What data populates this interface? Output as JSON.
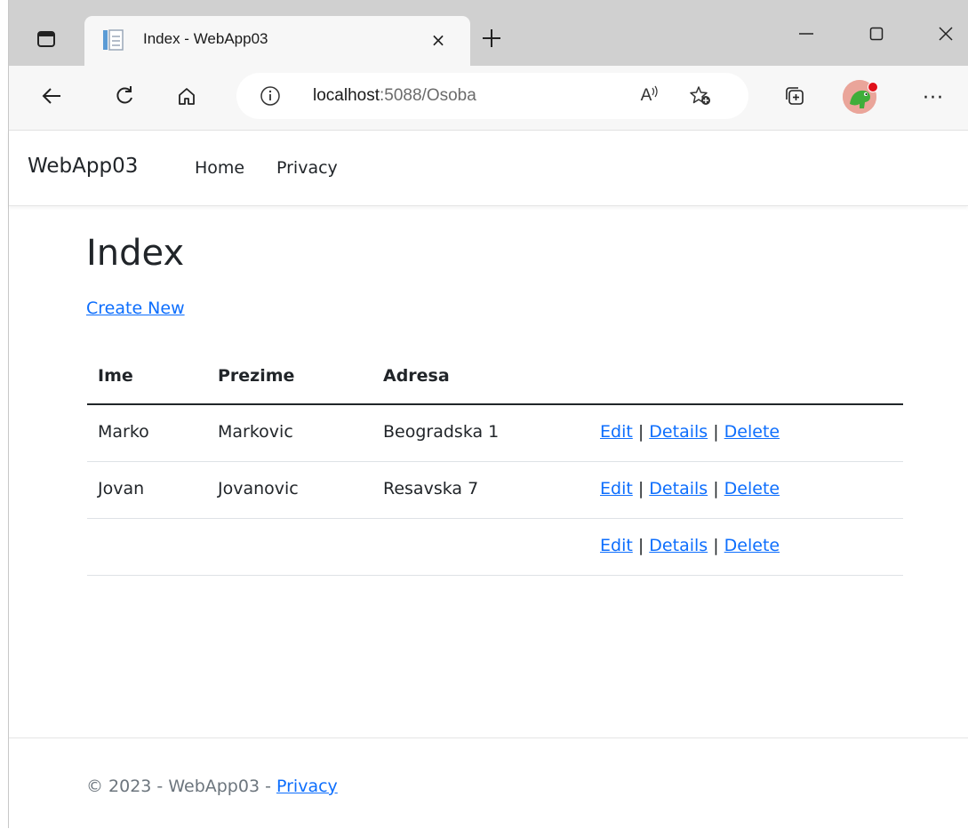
{
  "browser": {
    "tab_title": "Index - WebApp03",
    "tab_close": "×",
    "url_host": "localhost",
    "url_path": ":5088/Osoba",
    "menu_label": "···",
    "read_aloud_label": "A",
    "icons": [
      "tab-actions-icon",
      "page-favicon",
      "close-icon",
      "plus-icon",
      "minimize-icon",
      "maximize-icon",
      "close-window-icon",
      "back-arrow-icon",
      "refresh-icon",
      "home-icon",
      "info-icon",
      "read-aloud-icon",
      "add-favorite-icon",
      "collections-icon",
      "profile-avatar",
      "more-menu-icon"
    ]
  },
  "navbar": {
    "brand": "WebApp03",
    "links": [
      "Home",
      "Privacy"
    ]
  },
  "main": {
    "title": "Index",
    "create_new": "Create New",
    "table": {
      "headers": [
        "Ime",
        "Prezime",
        "Adresa"
      ],
      "rows": [
        {
          "ime": "Marko",
          "prezime": "Markovic",
          "adresa": "Beogradska 1"
        },
        {
          "ime": "Jovan",
          "prezime": "Jovanovic",
          "adresa": "Resavska 7"
        },
        {
          "ime": "",
          "prezime": "",
          "adresa": ""
        }
      ],
      "action_edit": "Edit",
      "action_details": "Details",
      "action_delete": "Delete",
      "separator": "|"
    }
  },
  "footer": {
    "text": "© 2023 - WebApp03 - ",
    "privacy": "Privacy"
  },
  "colors": {
    "link": "#0d6efd",
    "tabbar": "#d0d0d0",
    "toolbar": "#f7f7f7",
    "text": "#212529",
    "muted": "#6c757d"
  }
}
